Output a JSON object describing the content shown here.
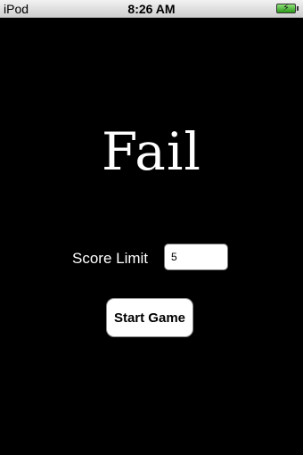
{
  "status_bar": {
    "carrier": "iPod",
    "time": "8:26 AM",
    "battery_icon": "battery-charging-icon",
    "charging_glyph": "⚡"
  },
  "main": {
    "title": "Fail",
    "score_limit_label": "Score Limit",
    "score_limit_value": "5",
    "start_button_label": "Start Game"
  },
  "colors": {
    "background": "#000000",
    "text": "#ffffff",
    "battery": "#2c9a1a"
  }
}
